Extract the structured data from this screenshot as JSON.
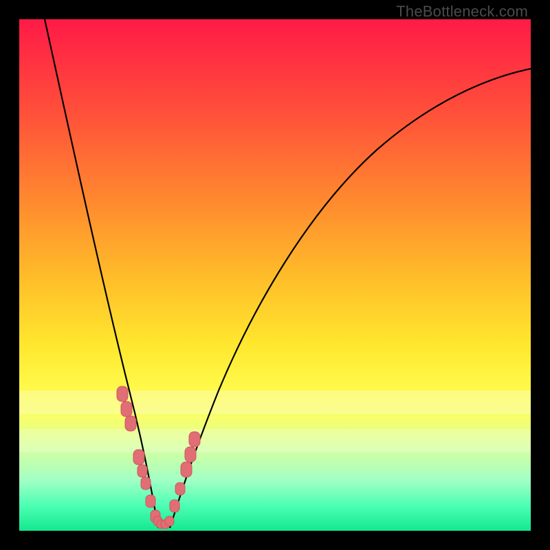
{
  "attribution": "TheBottleneck.com",
  "colors": {
    "frame": "#000000",
    "curve": "#000000",
    "marker_fill": "#e06e74",
    "marker_stroke": "#cf575e"
  },
  "chart_data": {
    "type": "line",
    "title": "",
    "xlabel": "",
    "ylabel": "",
    "xlim": [
      0,
      100
    ],
    "ylim": [
      0,
      100
    ],
    "grid": false,
    "legend": false,
    "note": "Axes are unlabeled; values inferred from normalized 0–100 plot coordinates (x left→right, y bottom→top).",
    "series": [
      {
        "name": "left-branch",
        "x": [
          5,
          8,
          12,
          15,
          18,
          20,
          22,
          24,
          25.5,
          26.5,
          27.2
        ],
        "y": [
          100,
          82,
          60,
          46,
          34,
          26,
          19,
          11,
          6,
          3,
          0.5
        ]
      },
      {
        "name": "right-branch",
        "x": [
          29.4,
          30.5,
          32.5,
          35,
          40,
          48,
          58,
          70,
          82,
          92,
          100
        ],
        "y": [
          0.5,
          4,
          11,
          19,
          32,
          48,
          62,
          74,
          82,
          87,
          90
        ]
      }
    ],
    "markers": {
      "name": "highlighted-points",
      "shape": "rounded-rect",
      "x": [
        20.0,
        20.8,
        21.6,
        23.2,
        24.0,
        24.6,
        25.5,
        26.5,
        27.0,
        27.7,
        28.5,
        29.3,
        30.3,
        31.3,
        32.5,
        33.3,
        34.0
      ],
      "y": [
        27.0,
        24.0,
        21.0,
        14.5,
        11.5,
        9.0,
        5.5,
        2.5,
        1.3,
        0.6,
        0.6,
        1.3,
        4.5,
        8.0,
        12.0,
        15.0,
        18.0
      ]
    }
  }
}
